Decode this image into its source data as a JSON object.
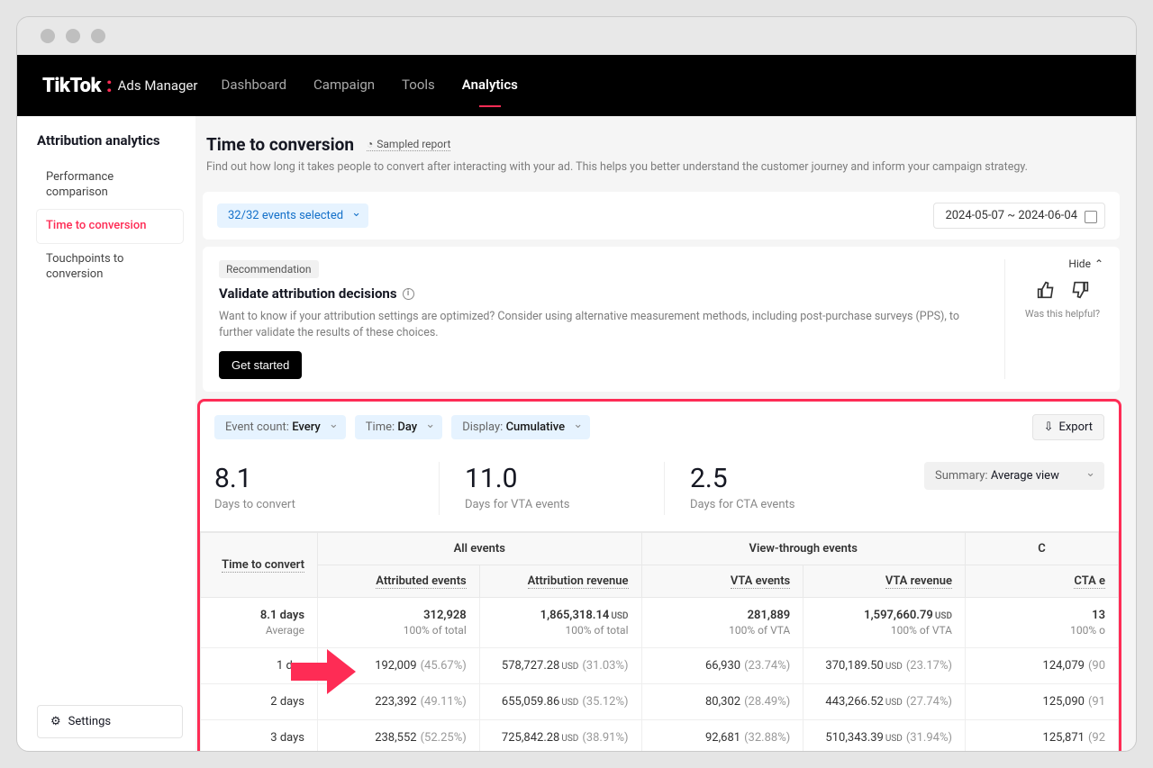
{
  "brand": {
    "logo": "TikTok",
    "sub": "Ads Manager"
  },
  "nav": {
    "dashboard": "Dashboard",
    "campaign": "Campaign",
    "tools": "Tools",
    "analytics": "Analytics"
  },
  "sidebar": {
    "title": "Attribution analytics",
    "items": [
      "Performance comparison",
      "Time to conversion",
      "Touchpoints to conversion"
    ],
    "settings": "Settings"
  },
  "header": {
    "title": "Time to conversion",
    "sampled": "Sampled report",
    "desc": "Find out how long it takes people to convert after interacting with your ad. This helps you better understand the customer journey and inform your campaign strategy."
  },
  "filters": {
    "events_selected": "32/32 events selected",
    "date_range": "2024-05-07 ~ 2024-06-04"
  },
  "reco": {
    "tag": "Recommendation",
    "title": "Validate attribution decisions",
    "desc": "Want to know if your attribution settings are optimized? Consider using alternative measurement methods, including post-purchase surveys (PPS), to further validate the results of these choices.",
    "cta": "Get started",
    "hide": "Hide",
    "helpful": "Was this helpful?"
  },
  "controls": {
    "event_count_label": "Event count:",
    "event_count_value": "Every",
    "time_label": "Time:",
    "time_value": "Day",
    "display_label": "Display:",
    "display_value": "Cumulative",
    "export": "Export"
  },
  "stats": {
    "s1_num": "8.1",
    "s1_lab": "Days to convert",
    "s2_num": "11.0",
    "s2_lab": "Days for VTA events",
    "s3_num": "2.5",
    "s3_lab": "Days for CTA events",
    "summary_label": "Summary:",
    "summary_value": "Average view"
  },
  "table": {
    "group_all": "All events",
    "group_vt": "View-through events",
    "group_ct": "C",
    "h_time": "Time to convert",
    "h_ae": "Attributed events",
    "h_ar": "Attribution revenue",
    "h_ve": "VTA events",
    "h_vr": "VTA revenue",
    "h_ce": "CTA e",
    "summary": {
      "time": "8.1 days",
      "time_sub": "Average",
      "ae": "312,928",
      "ae_sub": "100% of total",
      "ar": "1,865,318.14",
      "ar_sub": "100% of total",
      "ve": "281,889",
      "ve_sub": "100% of VTA",
      "vr": "1,597,660.79",
      "vr_sub": "100% of VTA",
      "ce": "13",
      "ce_sub": "100% o"
    },
    "rows": [
      {
        "time": "1 day",
        "ae": "192,009",
        "ae_pct": "(45.67%)",
        "ar": "578,727.28",
        "ar_pct": "(31.03%)",
        "ve": "66,930",
        "ve_pct": "(23.74%)",
        "vr": "370,189.50",
        "vr_pct": "(23.17%)",
        "ce": "124,079",
        "ce_pct": "(90"
      },
      {
        "time": "2 days",
        "ae": "223,392",
        "ae_pct": "(49.11%)",
        "ar": "655,059.86",
        "ar_pct": "(35.12%)",
        "ve": "80,302",
        "ve_pct": "(28.49%)",
        "vr": "443,266.52",
        "vr_pct": "(27.74%)",
        "ce": "125,090",
        "ce_pct": "(91"
      },
      {
        "time": "3 days",
        "ae": "238,552",
        "ae_pct": "(52.25%)",
        "ar": "725,842.28",
        "ar_pct": "(38.91%)",
        "ve": "92,681",
        "ve_pct": "(32.88%)",
        "vr": "510,343.39",
        "vr_pct": "(31.94%)",
        "ce": "125,871",
        "ce_pct": "(92"
      }
    ]
  }
}
